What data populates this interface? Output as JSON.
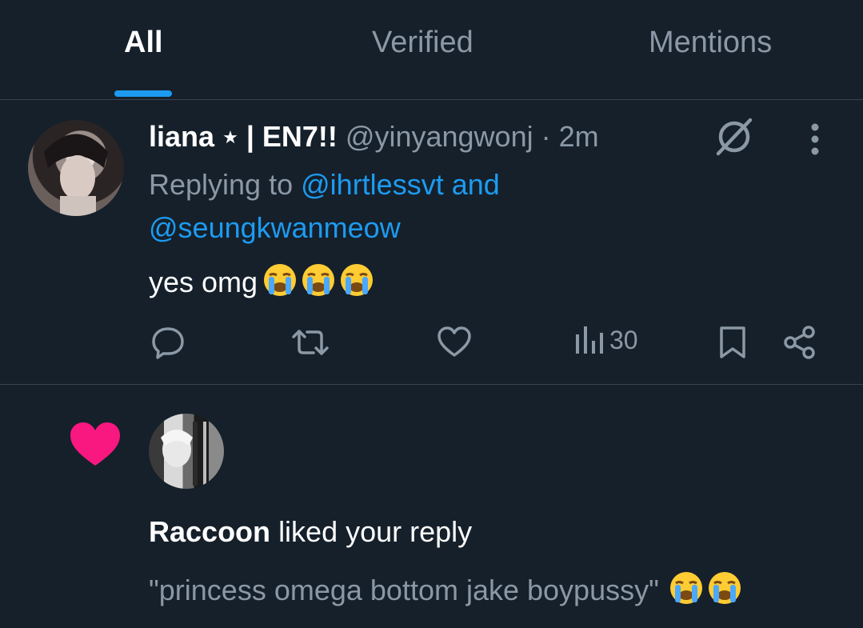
{
  "tabs": [
    {
      "label": "All",
      "active": true
    },
    {
      "label": "Verified",
      "active": false
    },
    {
      "label": "Mentions",
      "active": false
    }
  ],
  "reply": {
    "display_name": "liana",
    "name_star": "★",
    "name_suffix": "| EN7!!",
    "handle": "@yinyangwonj",
    "separator": "·",
    "time": "2m",
    "replying_prefix": "Replying to",
    "reply_to_1": "@ihrtlessvt",
    "reply_and": "and",
    "reply_to_2": "@seungkwanmeow",
    "text": "yes omg",
    "text_emojis": "😭😭😭",
    "views": "30",
    "icons": [
      "reply-icon",
      "retweet-icon",
      "like-icon",
      "views-icon",
      "bookmark-icon",
      "share-icon",
      "grok-icon",
      "more-icon"
    ]
  },
  "like_notification": {
    "user": "Raccoon",
    "action": "liked your reply",
    "quote": "\"princess omega bottom jake boypussy\"",
    "quote_emojis": "😭😭",
    "heart_color": "#f91880"
  },
  "colors": {
    "background": "#15202b",
    "accent": "#1d9bf0",
    "muted": "#8b98a5",
    "divider": "#38444d"
  }
}
